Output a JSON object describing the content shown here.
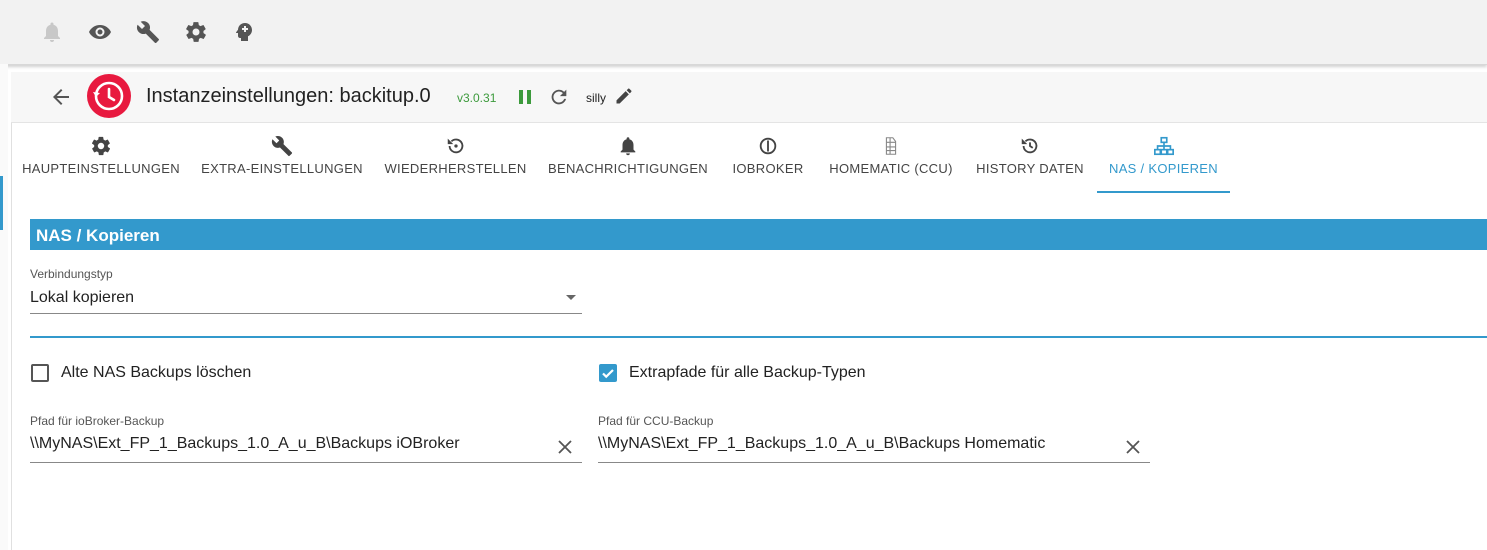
{
  "toolbar": {
    "icons": [
      "bell-icon",
      "eye-icon",
      "wrench-icon",
      "gear-icon",
      "expert-mode-icon"
    ]
  },
  "header": {
    "title": "Instanzeinstellungen: backitup.0",
    "version": "v3.0.31",
    "log_level": "silly"
  },
  "tabs": [
    {
      "label": "HAUPTEINSTELLUNGEN",
      "icon": "gear-icon"
    },
    {
      "label": "EXTRA-EINSTELLUNGEN",
      "icon": "wrench-icon"
    },
    {
      "label": "WIEDERHERSTELLEN",
      "icon": "restore-icon"
    },
    {
      "label": "BENACHRICHTIGUNGEN",
      "icon": "bell-icon"
    },
    {
      "label": "IOBROKER",
      "icon": "iobroker-icon"
    },
    {
      "label": "HOMEMATIC (CCU)",
      "icon": "homematic-icon"
    },
    {
      "label": "HISTORY DATEN",
      "icon": "history-icon"
    },
    {
      "label": "NAS / KOPIEREN",
      "icon": "network-icon",
      "active": true
    }
  ],
  "section": {
    "title": "NAS / Kopieren"
  },
  "connection": {
    "label": "Verbindungstyp",
    "value": "Lokal kopieren"
  },
  "checkboxes": {
    "delete_old": {
      "label": "Alte NAS Backups löschen",
      "checked": false
    },
    "extra_paths": {
      "label": "Extrapfade für alle Backup-Typen",
      "checked": true
    }
  },
  "paths": {
    "iobroker": {
      "label": "Pfad für ioBroker-Backup",
      "value": "\\\\MyNAS\\Ext_FP_1_Backups_1.0_A_u_B\\Backups iOBroker"
    },
    "ccu": {
      "label": "Pfad für CCU-Backup",
      "value": "\\\\MyNAS\\Ext_FP_1_Backups_1.0_A_u_B\\Backups Homematic"
    }
  },
  "colors": {
    "accent": "#3399cc",
    "logo": "#e8193f",
    "version": "#3c9a3c"
  }
}
